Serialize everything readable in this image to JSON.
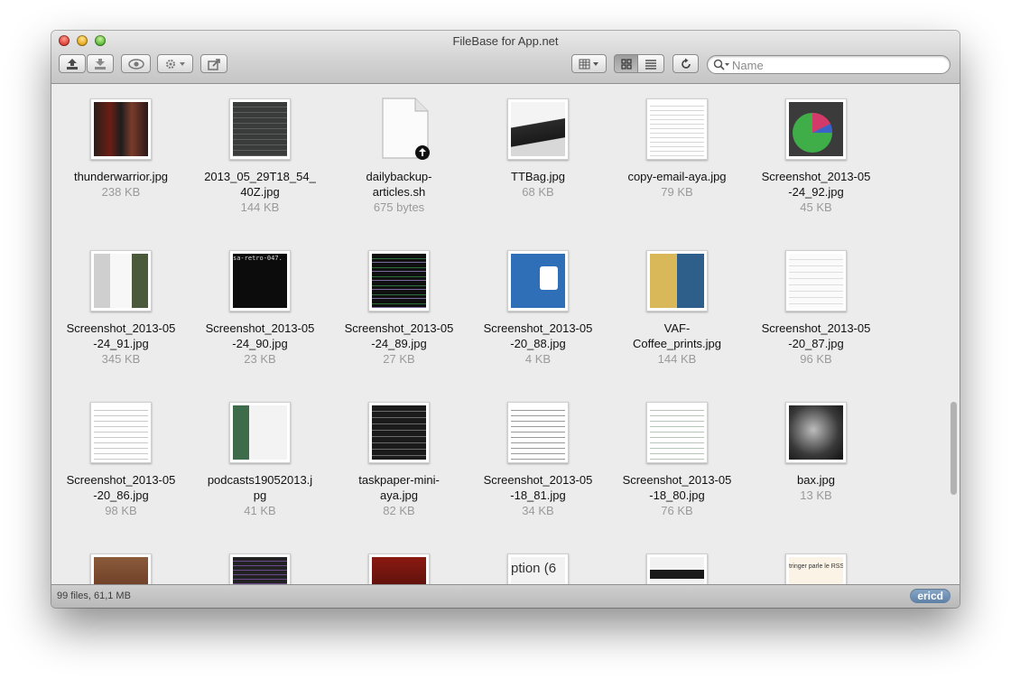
{
  "window": {
    "title": "FileBase for App.net"
  },
  "toolbar": {
    "search_placeholder": "Name",
    "icons": [
      "upload-icon",
      "download-icon",
      "eye-icon",
      "gear-icon",
      "share-icon",
      "column-view-icon",
      "icon-view-icon",
      "list-view-icon",
      "refresh-icon",
      "search-icon"
    ]
  },
  "files": [
    {
      "name": "thunderwarrior.jpg",
      "size": "238 KB",
      "kind": "image"
    },
    {
      "name": "2013_05_29T18_54_ 40Z.jpg",
      "size": "144 KB",
      "kind": "image"
    },
    {
      "name": "dailybackup- articles.sh",
      "size": "675 bytes",
      "kind": "script"
    },
    {
      "name": "TTBag.jpg",
      "size": "68 KB",
      "kind": "image"
    },
    {
      "name": "copy-email-aya.jpg",
      "size": "79 KB",
      "kind": "image"
    },
    {
      "name": "Screenshot_2013-05 -24_92.jpg",
      "size": "45 KB",
      "kind": "image"
    },
    {
      "name": "Screenshot_2013-05 -24_91.jpg",
      "size": "345 KB",
      "kind": "image"
    },
    {
      "name": "Screenshot_2013-05 -24_90.jpg",
      "size": "23 KB",
      "kind": "image"
    },
    {
      "name": "Screenshot_2013-05 -24_89.jpg",
      "size": "27 KB",
      "kind": "image"
    },
    {
      "name": "Screenshot_2013-05 -20_88.jpg",
      "size": "4 KB",
      "kind": "image"
    },
    {
      "name": "VAF- Coffee_prints.jpg",
      "size": "144 KB",
      "kind": "image"
    },
    {
      "name": "Screenshot_2013-05 -20_87.jpg",
      "size": "96 KB",
      "kind": "image"
    },
    {
      "name": "Screenshot_2013-05 -20_86.jpg",
      "size": "98 KB",
      "kind": "image"
    },
    {
      "name": "podcasts19052013.j pg",
      "size": "41 KB",
      "kind": "image"
    },
    {
      "name": "taskpaper-mini- aya.jpg",
      "size": "82 KB",
      "kind": "image"
    },
    {
      "name": "Screenshot_2013-05 -18_81.jpg",
      "size": "34 KB",
      "kind": "image"
    },
    {
      "name": "Screenshot_2013-05 -18_80.jpg",
      "size": "76 KB",
      "kind": "image"
    },
    {
      "name": "bax.jpg",
      "size": "13 KB",
      "kind": "image"
    },
    {
      "name": "",
      "size": "",
      "kind": "image"
    },
    {
      "name": "",
      "size": "",
      "kind": "image"
    },
    {
      "name": "",
      "size": "",
      "kind": "image"
    },
    {
      "name": "",
      "size": "",
      "kind": "image"
    },
    {
      "name": "",
      "size": "",
      "kind": "image"
    },
    {
      "name": "",
      "size": "",
      "kind": "image"
    }
  ],
  "thumb_text": {
    "t8": "sa-retro-047. \"git commit - ages/thumbs/c",
    "t10": "ption (6",
    "t23": "tringer parle le RSS."
  },
  "status": {
    "summary": "99 files, 61,1 MB",
    "user": "ericd"
  },
  "colors": {
    "window_bg": "#ececec",
    "accent_badge": "#6b8db3"
  }
}
